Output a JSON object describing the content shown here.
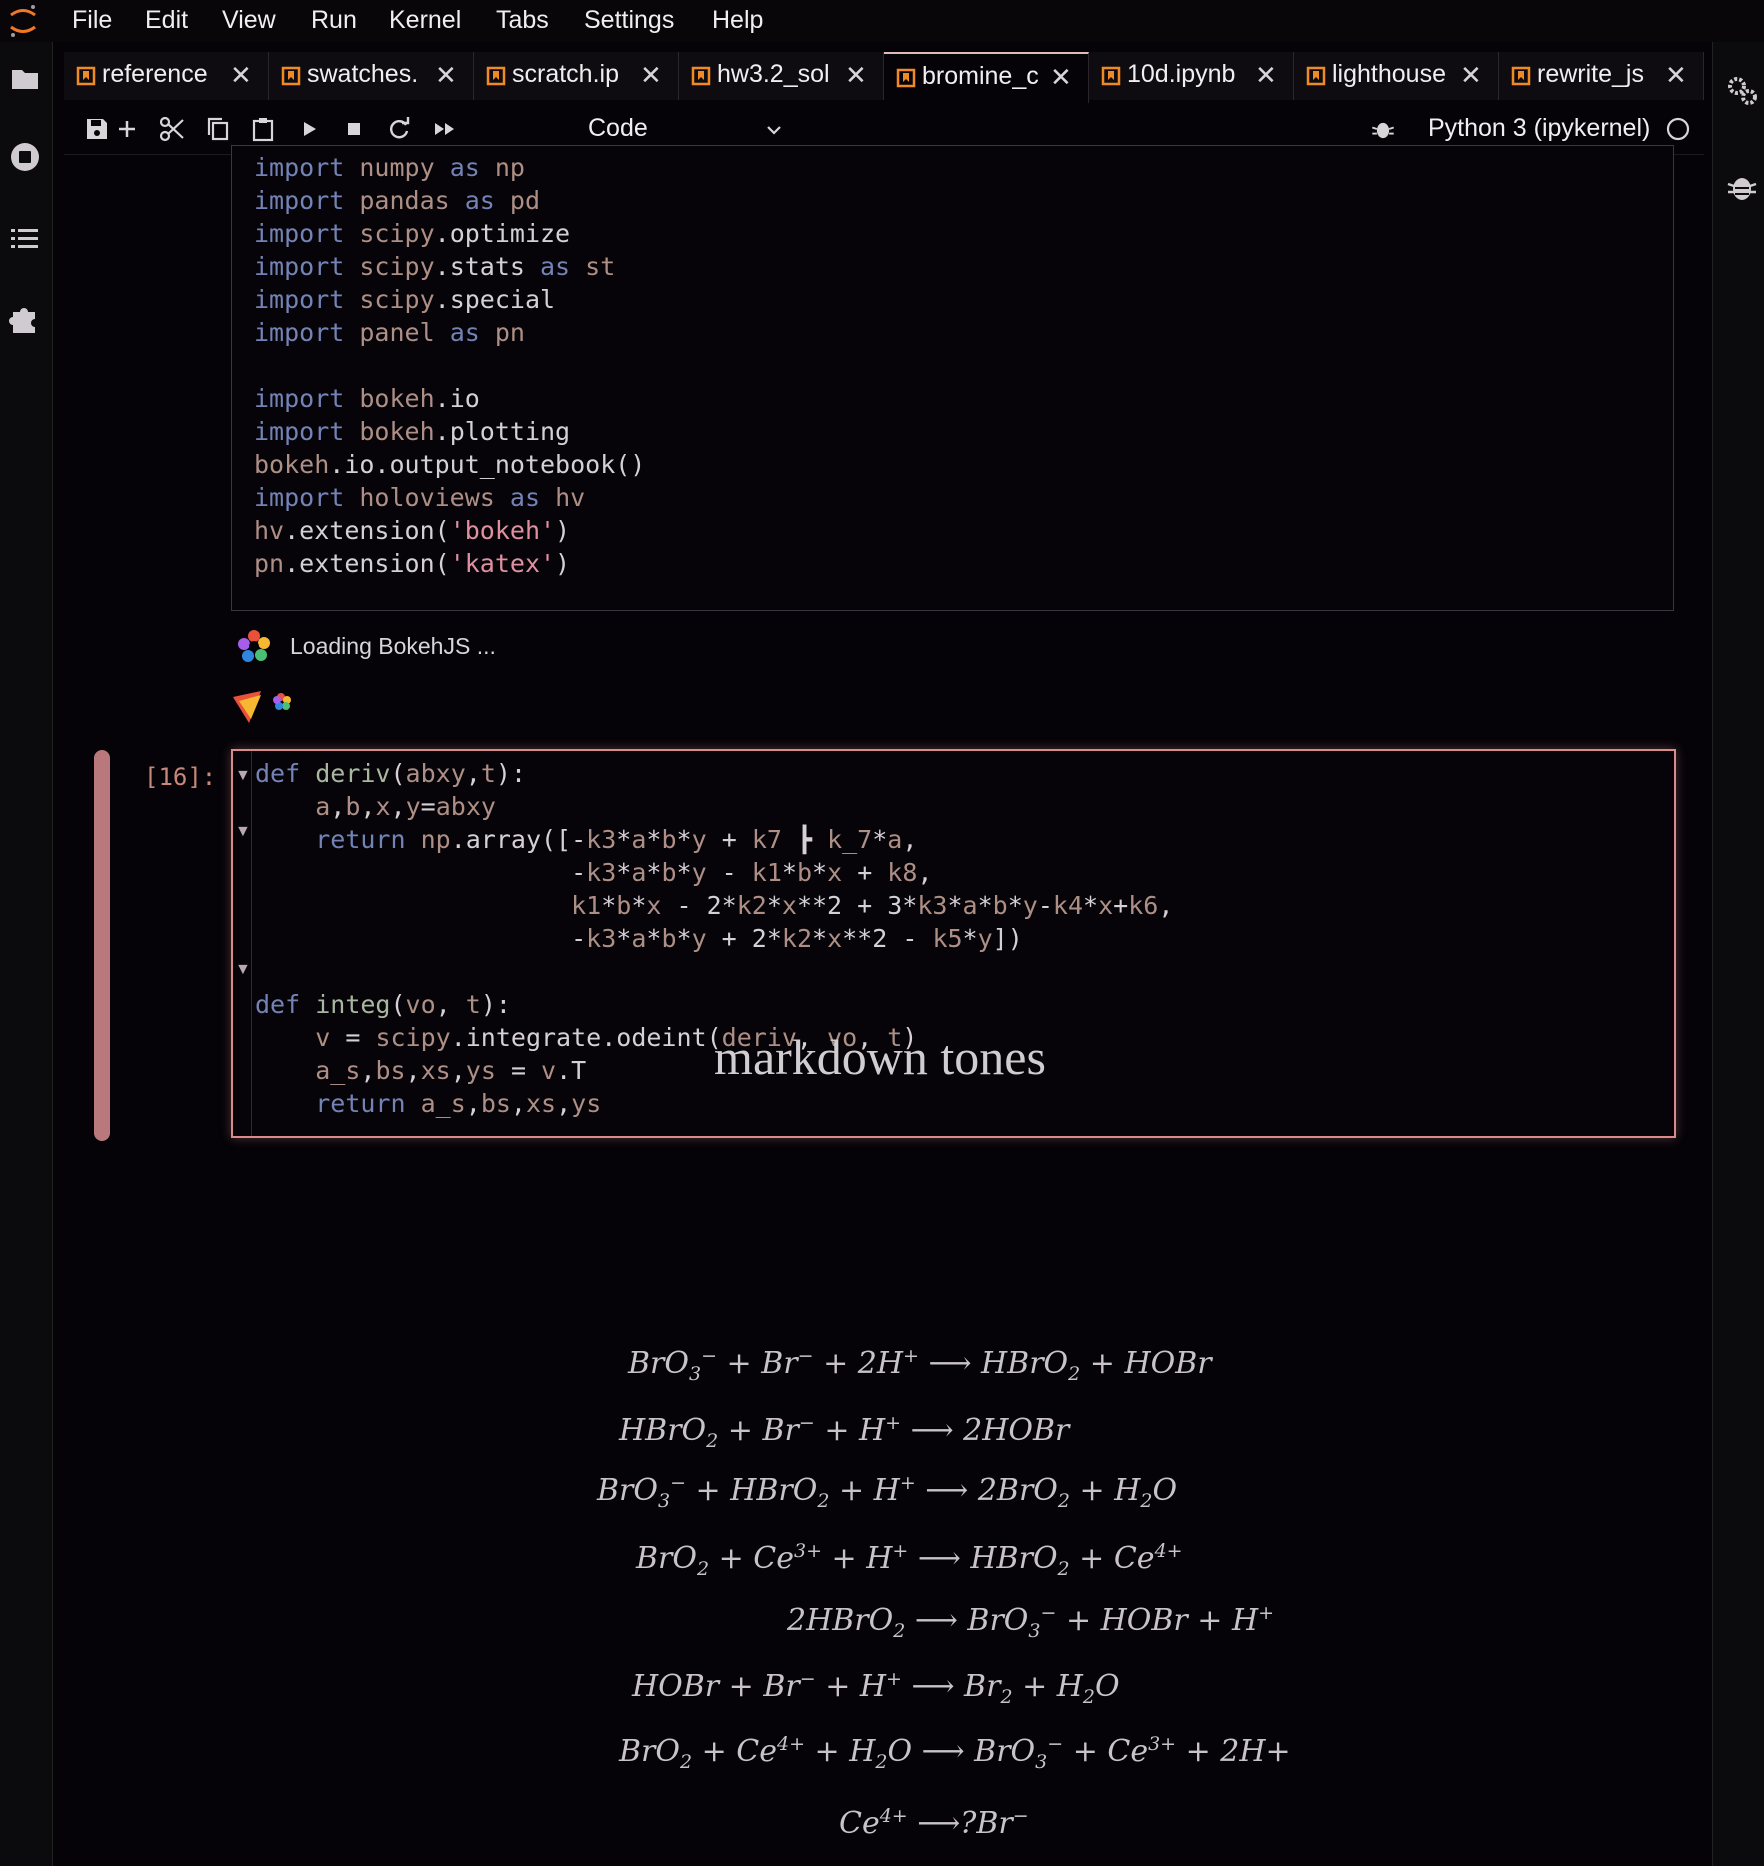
{
  "menu": [
    "File",
    "Edit",
    "View",
    "Run",
    "Kernel",
    "Tabs",
    "Settings",
    "Help"
  ],
  "tabs": [
    {
      "label": "reference"
    },
    {
      "label": "swatches."
    },
    {
      "label": "scratch.ip"
    },
    {
      "label": "hw3.2_sol"
    },
    {
      "label": "bromine_c"
    },
    {
      "label": "10d.ipynb"
    },
    {
      "label": "lighthouse"
    },
    {
      "label": "rewrite_js"
    }
  ],
  "toolbar": {
    "cell_type": "Code",
    "kernel": "Python 3 (ipykernel)"
  },
  "output": {
    "loading_text": "Loading BokehJS ..."
  },
  "cell16": {
    "prompt": "[16]:"
  },
  "markdown": {
    "heading": "markdown tones"
  },
  "colors": {
    "accent": "#e0b9b8",
    "active_cell_bar": "#b9797c",
    "prompt": "#c8877a",
    "keyword": "#7483b5",
    "tab_icon": "#f08a24"
  }
}
